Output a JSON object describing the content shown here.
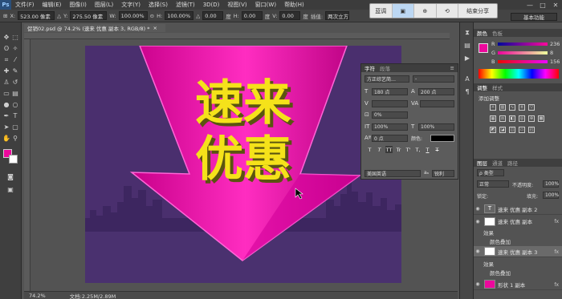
{
  "app": {
    "logo": "Ps"
  },
  "menu": [
    "文件(F)",
    "编辑(E)",
    "图像(I)",
    "图层(L)",
    "文字(Y)",
    "选择(S)",
    "滤镜(T)",
    "3D(D)",
    "视图(V)",
    "窗口(W)",
    "帮助(H)"
  ],
  "window_controls": [
    "—",
    "□",
    "✕"
  ],
  "options": {
    "x_label": "X:",
    "x_value": "523.00 像素",
    "y_label": "Y:",
    "y_value": "275.50 像素",
    "w_label": "W:",
    "w_value": "100.00%",
    "h_label": "H:",
    "h_value": "100.00%",
    "angle_value": "0.00",
    "deg1": "度",
    "hskew_label": "H:",
    "hskew_value": "0.00",
    "deg2": "度",
    "v_label": "V:",
    "v_value": "0.00",
    "deg3": "度",
    "interp_label": "插值:",
    "interp_value": "两次立方"
  },
  "view_controls": [
    "蓝调",
    "▣",
    "⊕",
    "⟲",
    "结束分享"
  ],
  "workspace": "基本功能",
  "document": {
    "tab": "促销02.psd @ 74.2% (速来 优惠 副本 3, RGB/8) *",
    "close": "×",
    "zoom": "74.2%",
    "doc_size": "文档:2.25M/2.89M"
  },
  "canvas": {
    "line1": "速来",
    "line2": "优惠"
  },
  "character_panel": {
    "tab_active": "字符",
    "tab_other": "段落",
    "font_family": "方正综艺简…",
    "font_style": "-",
    "size": "180 点",
    "leading": "200 点",
    "kerning": "",
    "tracking": "0%",
    "vscale": "100%",
    "hscale": "100%",
    "baseline": "0 点",
    "color_label": "颜色:",
    "style_buttons": [
      "T",
      "T",
      "TT",
      "Tr",
      "T'",
      "T,",
      "T",
      "T"
    ],
    "language": "美国英语",
    "aa_label": "aₐ",
    "aa_value": "锐利"
  },
  "color_panel": {
    "tab_active": "颜色",
    "tab_other": "色板",
    "r_label": "R",
    "r_value": "236",
    "g_label": "G",
    "g_value": "8",
    "b_label": "B",
    "b_value": "156"
  },
  "adjustments_panel": {
    "tab_active": "调整",
    "tab_other": "样式",
    "title": "添加调整"
  },
  "layers_panel": {
    "tabs": [
      "图层",
      "通道",
      "路径"
    ],
    "filter": "ρ 类型",
    "blend_mode": "正常",
    "opacity_label": "不透明度:",
    "opacity_value": "100%",
    "lock_label": "锁定:",
    "fill_label": "填充:",
    "fill_value": "100%",
    "layers": [
      {
        "name": "速来 优惠 副本 2",
        "kind": "text"
      },
      {
        "name": "速来 优惠 副本",
        "kind": "image"
      },
      {
        "name": "效果",
        "kind": "sub"
      },
      {
        "name": "颜色叠加",
        "kind": "sub"
      },
      {
        "name": "速来 优惠 副本 3",
        "kind": "image"
      },
      {
        "name": "效果",
        "kind": "sub"
      },
      {
        "name": "颜色叠加",
        "kind": "sub"
      },
      {
        "name": "形状 1 副本",
        "kind": "image"
      }
    ],
    "fx": "fx"
  },
  "colors": {
    "foreground": "#ec089c",
    "background": "#ffffff",
    "canvas_bg": "#4a2f6e",
    "text_yellow": "#f5e21a"
  }
}
